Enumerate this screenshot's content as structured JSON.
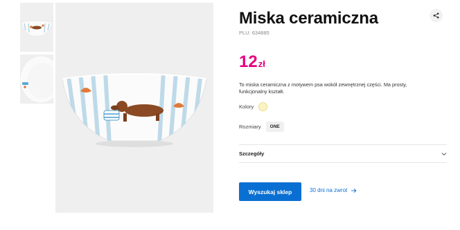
{
  "product": {
    "title": "Miska ceramiczna",
    "plu": "PLU: 634885",
    "price_amount": "12",
    "price_currency": "zł",
    "description": "To miska ceramiczna z motywem psa wokół zewnętrznej części. Ma prosty, funkcjonalny kształt.",
    "colors_label": "Kolory",
    "selected_color": "#fbf3c5",
    "sizes_label": "Rozmiary",
    "size_value": "ONE",
    "details_label": "Szczegóły",
    "store_button": "Wyszukaj sklep",
    "return_link": "30 dni na zwrot"
  },
  "icons": {
    "share": "share-icon",
    "chevron": "chevron-down-icon",
    "arrow": "arrow-right-icon"
  },
  "colors": {
    "accent_price": "#e6007e",
    "button_blue": "#0a6fd2"
  }
}
